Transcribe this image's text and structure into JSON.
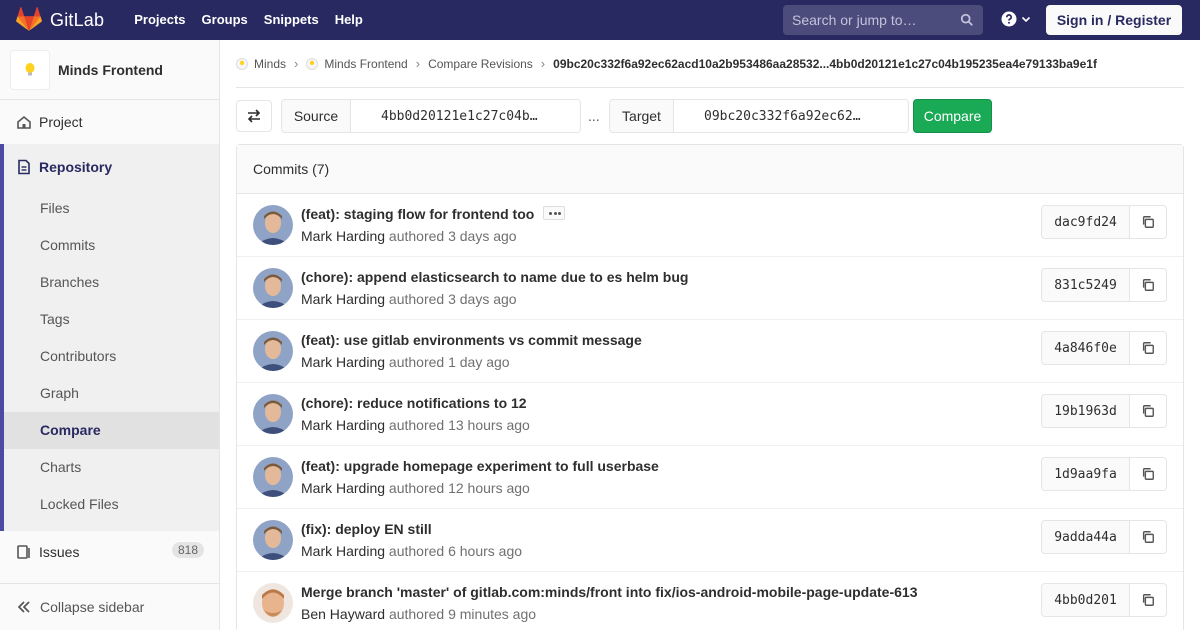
{
  "navbar": {
    "brand": "GitLab",
    "links": [
      "Projects",
      "Groups",
      "Snippets",
      "Help"
    ],
    "search_placeholder": "Search or jump to…",
    "sign_in": "Sign in / Register",
    "colors": {
      "bar": "#292961",
      "accent": "#fc6d26"
    }
  },
  "sidebar": {
    "project_name": "Minds Frontend",
    "project": "Project",
    "repository": "Repository",
    "repo_items": [
      "Files",
      "Commits",
      "Branches",
      "Tags",
      "Contributors",
      "Graph",
      "Compare",
      "Charts",
      "Locked Files"
    ],
    "active_item": "Compare",
    "issues": "Issues",
    "issues_count": "818",
    "collapse": "Collapse sidebar"
  },
  "breadcrumb": {
    "items": [
      "Minds",
      "Minds Frontend",
      "Compare Revisions"
    ],
    "current": "09bc20c332f6a92ec62acd10a2b953486aa28532...4bb0d20121e1c27c04b195235ea4e79133ba9e1f"
  },
  "compare": {
    "source_label": "Source",
    "source_value": "4bb0d20121e1c27c04b…",
    "separator": "...",
    "target_label": "Target",
    "target_value": "09bc20c332f6a92ec62…",
    "button": "Compare"
  },
  "commits": {
    "header": "Commits (7)",
    "items": [
      {
        "title": "(feat): staging flow for frontend too",
        "author": "Mark Harding",
        "authored": "authored 3 days ago",
        "sha": "dac9fd24",
        "has_ellipsis": true
      },
      {
        "title": "(chore): append elasticsearch to name due to es helm bug",
        "author": "Mark Harding",
        "authored": "authored 3 days ago",
        "sha": "831c5249"
      },
      {
        "title": "(feat): use gitlab environments vs commit message",
        "author": "Mark Harding",
        "authored": "authored 1 day ago",
        "sha": "4a846f0e"
      },
      {
        "title": "(chore): reduce notifications to 12",
        "author": "Mark Harding",
        "authored": "authored 13 hours ago",
        "sha": "19b1963d"
      },
      {
        "title": "(feat): upgrade homepage experiment to full userbase",
        "author": "Mark Harding",
        "authored": "authored 12 hours ago",
        "sha": "1d9aa9fa"
      },
      {
        "title": "(fix): deploy EN still",
        "author": "Mark Harding",
        "authored": "authored 6 hours ago",
        "sha": "9adda44a"
      },
      {
        "title": "Merge branch 'master' of gitlab.com:minds/front into fix/ios-android-mobile-page-update-613",
        "author": "Ben Hayward",
        "authored": "authored 9 minutes ago",
        "sha": "4bb0d201"
      }
    ]
  }
}
